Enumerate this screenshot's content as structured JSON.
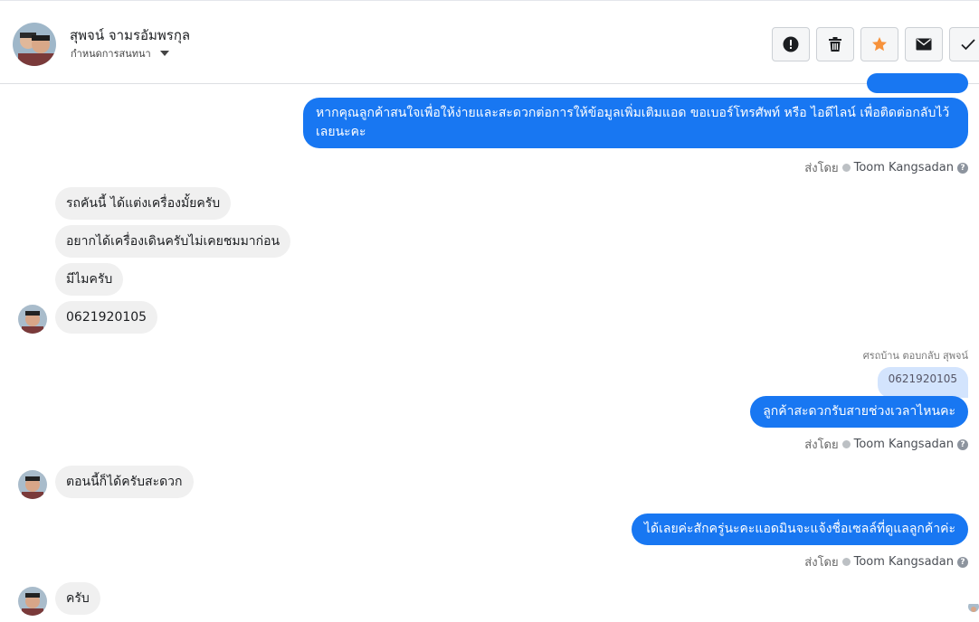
{
  "header": {
    "contact_name": "สุพจน์ จามรอัมพรกุล",
    "assign_label": "กำหนดการสนทนา",
    "tools": [
      "alert-icon",
      "trash-icon",
      "star-icon",
      "envelope-icon",
      "check-icon"
    ],
    "star_color": "#f7923b"
  },
  "messages": {
    "out1": "หากคุณลูกค้าสนใจเพื่อให้ง่ายและสะดวกต่อการให้ข้อมูลเพิ่มเติมแอด ขอเบอร์โทรศัพท์ หรือ ไอดีไลน์ เพื่อติดต่อกลับไว้เลยนะคะ",
    "sent_by_1": "ส่งโดย",
    "agent_1": "Toom Kangsadan",
    "in1": "รถคันนี้ ได้แต่งเครื่องมั้ยครับ",
    "in2": "อยากได้เครื่องเดินครับไม่เคยชมมาก่อน",
    "in3": "มีไมครับ",
    "in4": "0621920105",
    "reply_label": "ศรถบ้าน ตอบกลับ สุพจน์",
    "quoted": "0621920105",
    "out2": "ลูกค้าสะดวกรับสายช่วงเวลาไหนคะ",
    "sent_by_2": "ส่งโดย",
    "agent_2": "Toom Kangsadan",
    "in5": "ตอนนี้ก็ได้ครับสะดวก",
    "out3": "ได้เลยค่ะสักครู่นะคะแอดมินจะแจ้งชื่อเซลล์ที่ดูแลลูกค้าค่ะ",
    "sent_by_3": "ส่งโดย",
    "agent_3": "Toom Kangsadan",
    "in6": "ครับ"
  },
  "colors": {
    "outgoing": "#1877f2",
    "incoming": "#f0f0f0"
  }
}
